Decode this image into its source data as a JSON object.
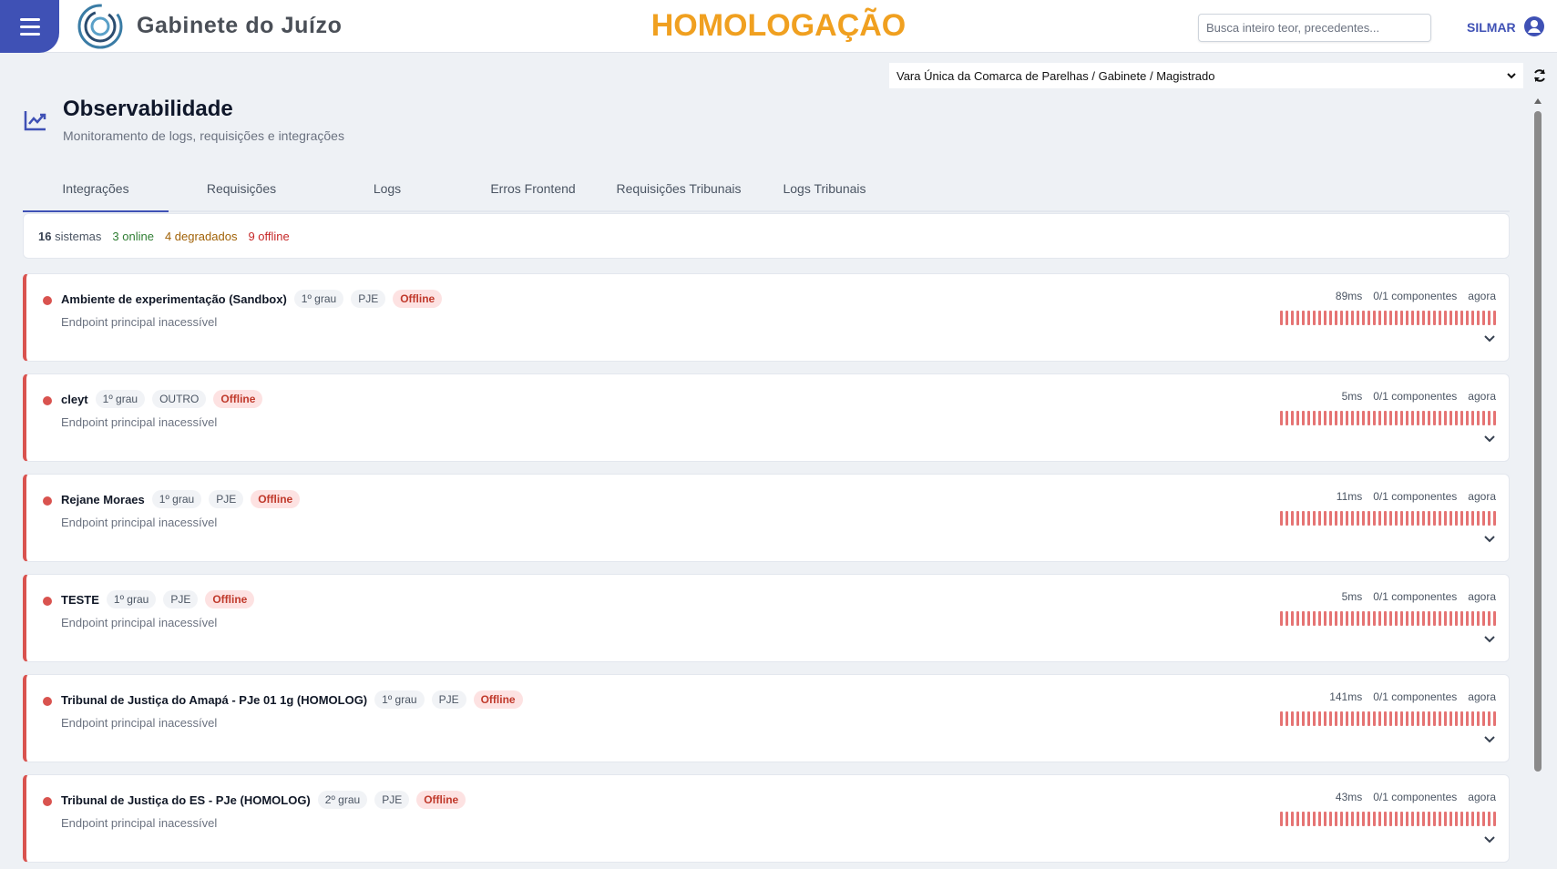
{
  "header": {
    "app_title": "Gabinete do Juízo",
    "environment": "HOMOLOGAÇÃO",
    "search_placeholder": "Busca inteiro teor, precedentes...",
    "user_name": "SILMAR",
    "menu_icon": "hamburger-menu-icon",
    "avatar_icon": "user-circle-icon"
  },
  "context": {
    "org_selected": "Vara Única da Comarca de Parelhas / Gabinete / Magistrado"
  },
  "page": {
    "title": "Observabilidade",
    "subtitle": "Monitoramento de logs, requisições e integrações",
    "icon": "trending-up-chart-icon"
  },
  "tabs": [
    {
      "label": "Integrações",
      "active": true
    },
    {
      "label": "Requisições",
      "active": false
    },
    {
      "label": "Logs",
      "active": false
    },
    {
      "label": "Erros Frontend",
      "active": false
    },
    {
      "label": "Requisições Tribunais",
      "active": false
    },
    {
      "label": "Logs Tribunais",
      "active": false
    }
  ],
  "summary": {
    "total_count": "16",
    "total_label": "sistemas",
    "online": "3 online",
    "degraded": "4 degradados",
    "offline": "9 offline"
  },
  "systems": [
    {
      "name": "Ambiente de experimentação (Sandbox)",
      "grau": "1º grau",
      "type": "PJE",
      "status": "Offline",
      "description": "Endpoint principal inacessível",
      "latency": "89ms",
      "components": "0/1 componentes",
      "updated": "agora"
    },
    {
      "name": "cleyt",
      "grau": "1º grau",
      "type": "OUTRO",
      "status": "Offline",
      "description": "Endpoint principal inacessível",
      "latency": "5ms",
      "components": "0/1 componentes",
      "updated": "agora"
    },
    {
      "name": "Rejane Moraes",
      "grau": "1º grau",
      "type": "PJE",
      "status": "Offline",
      "description": "Endpoint principal inacessível",
      "latency": "11ms",
      "components": "0/1 componentes",
      "updated": "agora"
    },
    {
      "name": "TESTE",
      "grau": "1º grau",
      "type": "PJE",
      "status": "Offline",
      "description": "Endpoint principal inacessível",
      "latency": "5ms",
      "components": "0/1 componentes",
      "updated": "agora"
    },
    {
      "name": "Tribunal de Justiça do Amapá - PJe 01 1g (HOMOLOG)",
      "grau": "1º grau",
      "type": "PJE",
      "status": "Offline",
      "description": "Endpoint principal inacessível",
      "latency": "141ms",
      "components": "0/1 componentes",
      "updated": "agora"
    },
    {
      "name": "Tribunal de Justiça do ES - PJe (HOMOLOG)",
      "grau": "2º grau",
      "type": "PJE",
      "status": "Offline",
      "description": "Endpoint principal inacessível",
      "latency": "43ms",
      "components": "0/1 componentes",
      "updated": "agora"
    }
  ],
  "colors": {
    "brand": "#3f51b5",
    "environment": "#f0a020",
    "offline": "#d9534f"
  }
}
